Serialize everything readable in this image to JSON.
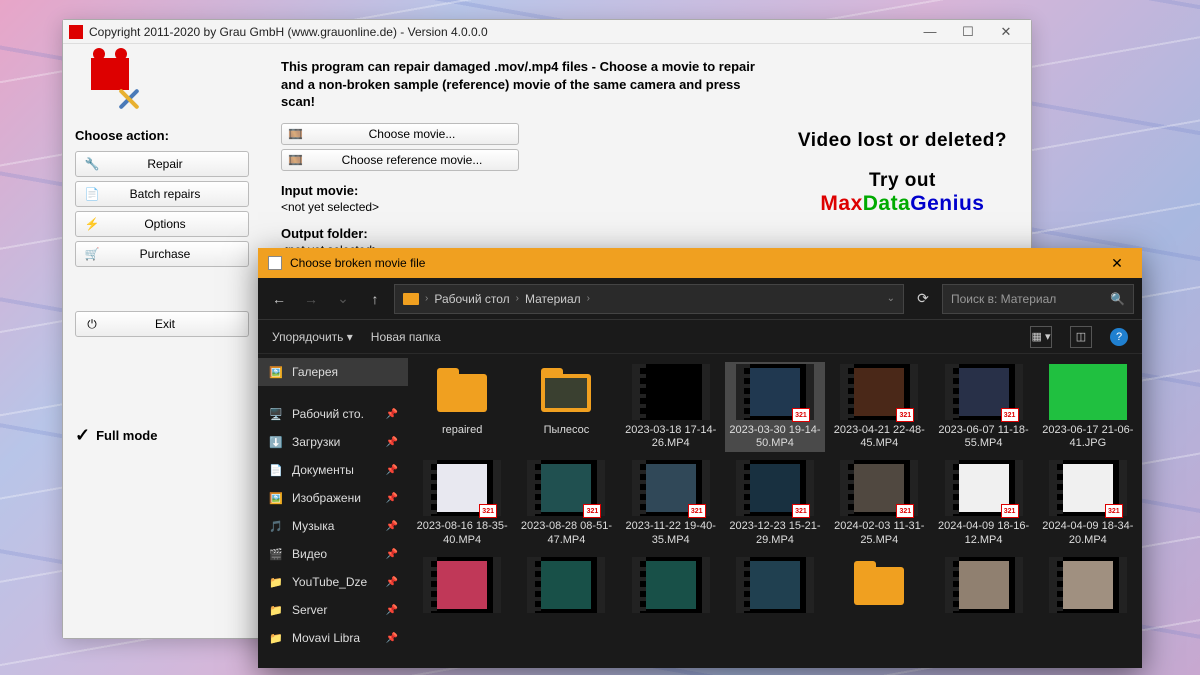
{
  "app": {
    "title": "Copyright 2011-2020 by Grau GmbH (www.grauonline.de) - Version 4.0.0.0",
    "intro": "This program can repair damaged .mov/.mp4 files - Choose a movie to repair and a non-broken sample (reference) movie of the same camera and press scan!",
    "choose_action": "Choose action:",
    "sidebar": [
      {
        "icon": "🔧",
        "label": "Repair"
      },
      {
        "icon": "📄",
        "label": "Batch repairs"
      },
      {
        "icon": "⚡",
        "label": "Options"
      },
      {
        "icon": "🛒",
        "label": "Purchase"
      },
      {
        "icon": "⏻",
        "label": "Exit"
      }
    ],
    "fullmode": "Full mode",
    "choose_movie": "Choose movie...",
    "choose_ref": "Choose reference movie...",
    "input_h": "Input movie:",
    "input_v": "<not yet selected>",
    "output_h": "Output folder:",
    "output_v": "<not yet selected>",
    "promo1": "Video lost or deleted?",
    "promo2": "Try out",
    "promo_m": "Max",
    "promo_d": "Data",
    "promo_g": "Genius"
  },
  "dlg": {
    "title": "Choose broken movie file",
    "crumb1": "Рабочий стол",
    "crumb2": "Материал",
    "search_ph": "Поиск в: Материал",
    "organize": "Упорядочить",
    "newfolder": "Новая папка",
    "side": [
      {
        "icon": "🖼️",
        "label": "Галерея",
        "sel": true
      },
      {
        "icon": "🖥️",
        "label": "Рабочий сто.",
        "pin": true
      },
      {
        "icon": "⬇️",
        "label": "Загрузки",
        "pin": true
      },
      {
        "icon": "📄",
        "label": "Документы",
        "pin": true
      },
      {
        "icon": "🖼️",
        "label": "Изображени",
        "pin": true
      },
      {
        "icon": "🎵",
        "label": "Музыка",
        "pin": true
      },
      {
        "icon": "🎬",
        "label": "Видео",
        "pin": true
      },
      {
        "icon": "📁",
        "label": "YouTube_Dze",
        "pin": true
      },
      {
        "icon": "📁",
        "label": "Server",
        "pin": true
      },
      {
        "icon": "📁",
        "label": "Movavi Libra",
        "pin": true
      }
    ],
    "files": [
      {
        "type": "folder",
        "name": "repaired"
      },
      {
        "type": "folder-thumb",
        "name": "Пылесос",
        "bg": "#3a4030"
      },
      {
        "type": "video",
        "name": "2023-03-18 17-14-26.MP4",
        "bg": "#000"
      },
      {
        "type": "video",
        "name": "2023-03-30 19-14-50.MP4",
        "bg": "#203850",
        "sel": true,
        "badge": true
      },
      {
        "type": "video",
        "name": "2023-04-21 22-48-45.MP4",
        "bg": "#4a2818",
        "badge": true
      },
      {
        "type": "video",
        "name": "2023-06-07 11-18-55.MP4",
        "bg": "#283048",
        "badge": true
      },
      {
        "type": "img",
        "name": "2023-06-17 21-06-41.JPG",
        "bg": "#20c040"
      },
      {
        "type": "video",
        "name": "2023-08-16 18-35-40.MP4",
        "bg": "#e8e8f0",
        "badge": true
      },
      {
        "type": "video",
        "name": "2023-08-28 08-51-47.MP4",
        "bg": "#205050",
        "badge": true
      },
      {
        "type": "video",
        "name": "2023-11-22 19-40-35.MP4",
        "bg": "#304858",
        "badge": true
      },
      {
        "type": "video",
        "name": "2023-12-23 15-21-29.MP4",
        "bg": "#183040",
        "badge": true
      },
      {
        "type": "video",
        "name": "2024-02-03 11-31-25.MP4",
        "bg": "#504840",
        "badge": true
      },
      {
        "type": "video",
        "name": "2024-04-09 18-16-12.MP4",
        "bg": "#f0f0f0",
        "badge": true
      },
      {
        "type": "video",
        "name": "2024-04-09 18-34-20.MP4",
        "bg": "#f0f0f0",
        "badge": true
      },
      {
        "type": "video",
        "name": "",
        "bg": "#c03858"
      },
      {
        "type": "video",
        "name": "",
        "bg": "#185048"
      },
      {
        "type": "video",
        "name": "",
        "bg": "#185048"
      },
      {
        "type": "video",
        "name": "",
        "bg": "#204050"
      },
      {
        "type": "folder",
        "name": ""
      },
      {
        "type": "video",
        "name": "",
        "bg": "#908070"
      },
      {
        "type": "video",
        "name": "",
        "bg": "#a09080"
      }
    ]
  }
}
